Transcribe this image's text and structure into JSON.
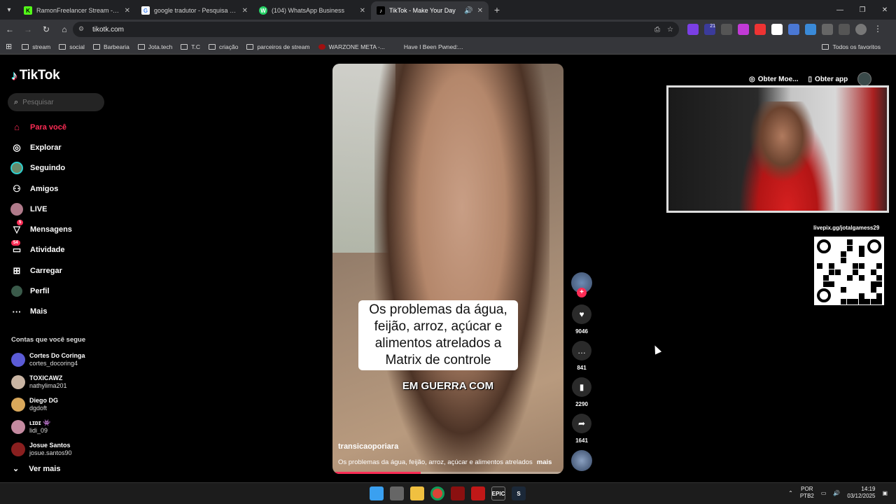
{
  "browser": {
    "tabs": [
      {
        "title": "RamonFreelancer Stream - Wat",
        "favicon": "K",
        "color": "#53fc18"
      },
      {
        "title": "google tradutor - Pesquisa Goo",
        "favicon": "G",
        "color": "#ffffff"
      },
      {
        "title": "(104) WhatsApp Business",
        "favicon": "W",
        "color": "#25d366"
      },
      {
        "title": "TikTok - Make Your Day",
        "favicon": "♪",
        "color": "#000000"
      }
    ],
    "url": "tikotk.com",
    "bookmarks": [
      "stream",
      "social",
      "Barbearia",
      "Jota.tech",
      "T.C",
      "criação",
      "parceiros de stream",
      "WARZONE META -...",
      "Have I Been Pwned:..."
    ],
    "all_bookmarks": "Todos os favoritos",
    "extension_badge": "21"
  },
  "tiktok": {
    "logo": "TikTok",
    "search_placeholder": "Pesquisar",
    "nav": [
      {
        "label": "Para você",
        "icon": "home-icon",
        "active": true
      },
      {
        "label": "Explorar",
        "icon": "compass-icon"
      },
      {
        "label": "Seguindo",
        "icon": "following-avatar-icon"
      },
      {
        "label": "Amigos",
        "icon": "friends-icon"
      },
      {
        "label": "LIVE",
        "icon": "live-avatar-icon"
      },
      {
        "label": "Mensagens",
        "icon": "messages-icon",
        "badge": "5"
      },
      {
        "label": "Atividade",
        "icon": "activity-icon",
        "badge": "54"
      },
      {
        "label": "Carregar",
        "icon": "upload-icon"
      },
      {
        "label": "Perfil",
        "icon": "profile-icon"
      },
      {
        "label": "Mais",
        "icon": "more-icon"
      }
    ],
    "following_title": "Contas que você segue",
    "following": [
      {
        "name": "Cortes Do Coringa",
        "handle": "cortes_docoring4",
        "color": "#5b5bd6"
      },
      {
        "name": "TOXICAWZ",
        "handle": "nathylima201",
        "color": "#c9b5a3"
      },
      {
        "name": "Diego DG",
        "handle": "dgdoft",
        "color": "#d9a85b"
      },
      {
        "name": "ʟɪᴅɪ 👾",
        "handle": "lidi_09",
        "color": "#c48aa0"
      },
      {
        "name": "Josue Santos",
        "handle": "josue.santos90",
        "color": "#8a1f1f"
      }
    ],
    "see_more": "Ver mais",
    "video": {
      "caption_box": "Os problemas da água, feijão, arroz, açúcar e alimentos atrelados a Matrix de controle",
      "subtitle": "EM GUERRA COM",
      "author": "transicaoporiara",
      "description": "Os problemas da água, feijão, arroz, açúcar e alimentos atrelados",
      "more": "mais",
      "progress": 0.38
    },
    "actions": {
      "likes": "9046",
      "comments": "841",
      "saves": "2290",
      "shares": "1641"
    },
    "top_right": {
      "coins": "Obter Moe...",
      "app": "Obter app"
    }
  },
  "overlay": {
    "qr_label": "livepix.gg/jotalgamess29"
  },
  "taskbar": {
    "lang": "POR",
    "layout": "PTB2",
    "time": "14:19",
    "date": "03/12/2025"
  }
}
